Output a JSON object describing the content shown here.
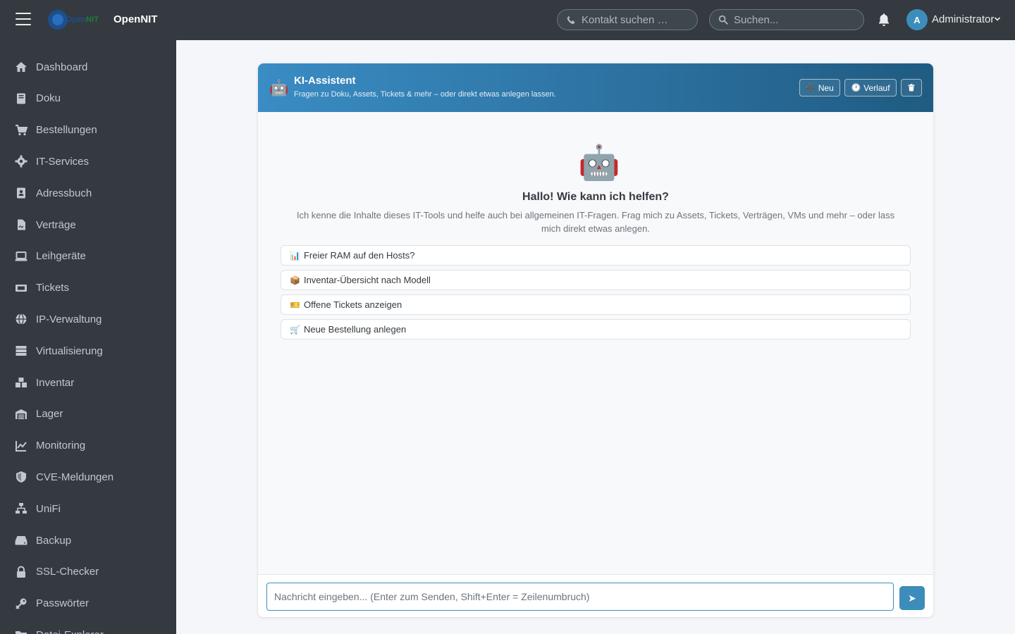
{
  "topbar": {
    "logo_text_open": "Open",
    "logo_text_nit": "NIT",
    "brand": "OpenNIT",
    "contact_search_placeholder": "Kontakt suchen …",
    "global_search_placeholder": "Suchen...",
    "user_initial": "A",
    "user_name": "Administrator"
  },
  "sidebar": {
    "items": [
      {
        "label": "Dashboard",
        "icon": "home-icon"
      },
      {
        "label": "Doku",
        "icon": "book-icon"
      },
      {
        "label": "Bestellungen",
        "icon": "cart-icon"
      },
      {
        "label": "IT-Services",
        "icon": "gear-icon"
      },
      {
        "label": "Adressbuch",
        "icon": "address-book-icon"
      },
      {
        "label": "Verträge",
        "icon": "contract-icon"
      },
      {
        "label": "Leihgeräte",
        "icon": "laptop-icon"
      },
      {
        "label": "Tickets",
        "icon": "ticket-icon"
      },
      {
        "label": "IP-Verwaltung",
        "icon": "globe-icon"
      },
      {
        "label": "Virtualisierung",
        "icon": "server-icon"
      },
      {
        "label": "Inventar",
        "icon": "boxes-icon"
      },
      {
        "label": "Lager",
        "icon": "warehouse-icon"
      },
      {
        "label": "Monitoring",
        "icon": "chart-line-icon"
      },
      {
        "label": "CVE-Meldungen",
        "icon": "shield-icon"
      },
      {
        "label": "UniFi",
        "icon": "network-icon"
      },
      {
        "label": "Backup",
        "icon": "hdd-icon"
      },
      {
        "label": "SSL-Checker",
        "icon": "lock-icon"
      },
      {
        "label": "Passwörter",
        "icon": "key-icon"
      },
      {
        "label": "Datei-Explorer",
        "icon": "folder-icon"
      }
    ]
  },
  "chat": {
    "title": "KI-Assistent",
    "subtitle": "Fragen zu Doku, Assets, Tickets & mehr – oder direkt etwas anlegen lassen.",
    "btn_new": "Neu",
    "btn_history": "Verlauf",
    "welcome_title": "Hallo! Wie kann ich helfen?",
    "welcome_text": "Ich kenne die Inhalte dieses IT-Tools und helfe auch bei allgemeinen IT-Fragen. Frag mich zu Assets, Tickets, Verträgen, VMs und mehr – oder lass mich direkt etwas anlegen.",
    "suggestions": [
      {
        "emoji": "📊",
        "label": "Freier RAM auf den Hosts?"
      },
      {
        "emoji": "📦",
        "label": "Inventar-Übersicht nach Modell"
      },
      {
        "emoji": "🎫",
        "label": "Offene Tickets anzeigen"
      },
      {
        "emoji": "🛒",
        "label": "Neue Bestellung anlegen"
      }
    ],
    "input_placeholder": "Nachricht eingeben... (Enter zum Senden, Shift+Enter = Zeilenumbruch)"
  },
  "colors": {
    "navbar": "#343a40",
    "sidebar": "#343a40",
    "accent": "#3c8dbc",
    "header_gradient_start": "#3a8cc4",
    "header_gradient_end": "#1f5b82"
  }
}
